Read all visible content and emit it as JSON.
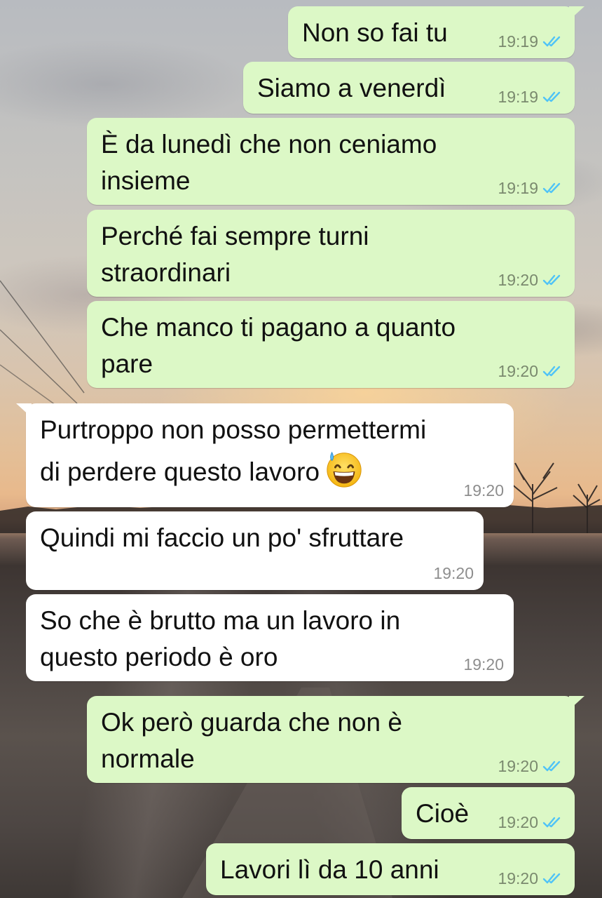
{
  "colors": {
    "outgoing_bubble": "#dcf8c6",
    "incoming_bubble": "#ffffff",
    "read_ticks": "#4fc3f7",
    "timestamp": "#8c8c8c"
  },
  "messages": [
    {
      "direction": "out",
      "text": "Non so fai tu",
      "time": "19:19",
      "status_icon": "double-check-read-icon"
    },
    {
      "direction": "out",
      "text": "Siamo a venerdì",
      "time": "19:19",
      "status_icon": "double-check-read-icon"
    },
    {
      "direction": "out",
      "text": "È da lunedì che non ceniamo\ninsieme",
      "time": "19:19",
      "status_icon": "double-check-read-icon"
    },
    {
      "direction": "out",
      "text": "Perché fai sempre turni\nstraordinari",
      "time": "19:20",
      "status_icon": "double-check-read-icon"
    },
    {
      "direction": "out",
      "text": "Che manco ti pagano a quanto\npare",
      "time": "19:20",
      "status_icon": "double-check-read-icon"
    },
    {
      "direction": "in",
      "text": "Purtroppo non posso permettermi\ndi perdere questo lavoro",
      "emoji": "grinning-face-with-sweat-emoji",
      "time": "19:20"
    },
    {
      "direction": "in",
      "text": "Quindi mi faccio un po' sfruttare",
      "time": "19:20"
    },
    {
      "direction": "in",
      "text": "So che è brutto ma un lavoro in\nquesto periodo è oro",
      "time": "19:20"
    },
    {
      "direction": "out",
      "text": "Ok però guarda che non è\nnormale",
      "time": "19:20",
      "status_icon": "double-check-read-icon"
    },
    {
      "direction": "out",
      "text": "Cioè",
      "time": "19:20",
      "status_icon": "double-check-read-icon"
    },
    {
      "direction": "out",
      "text": "Lavori lì da 10 anni",
      "time": "19:20",
      "status_icon": "double-check-read-icon"
    }
  ]
}
